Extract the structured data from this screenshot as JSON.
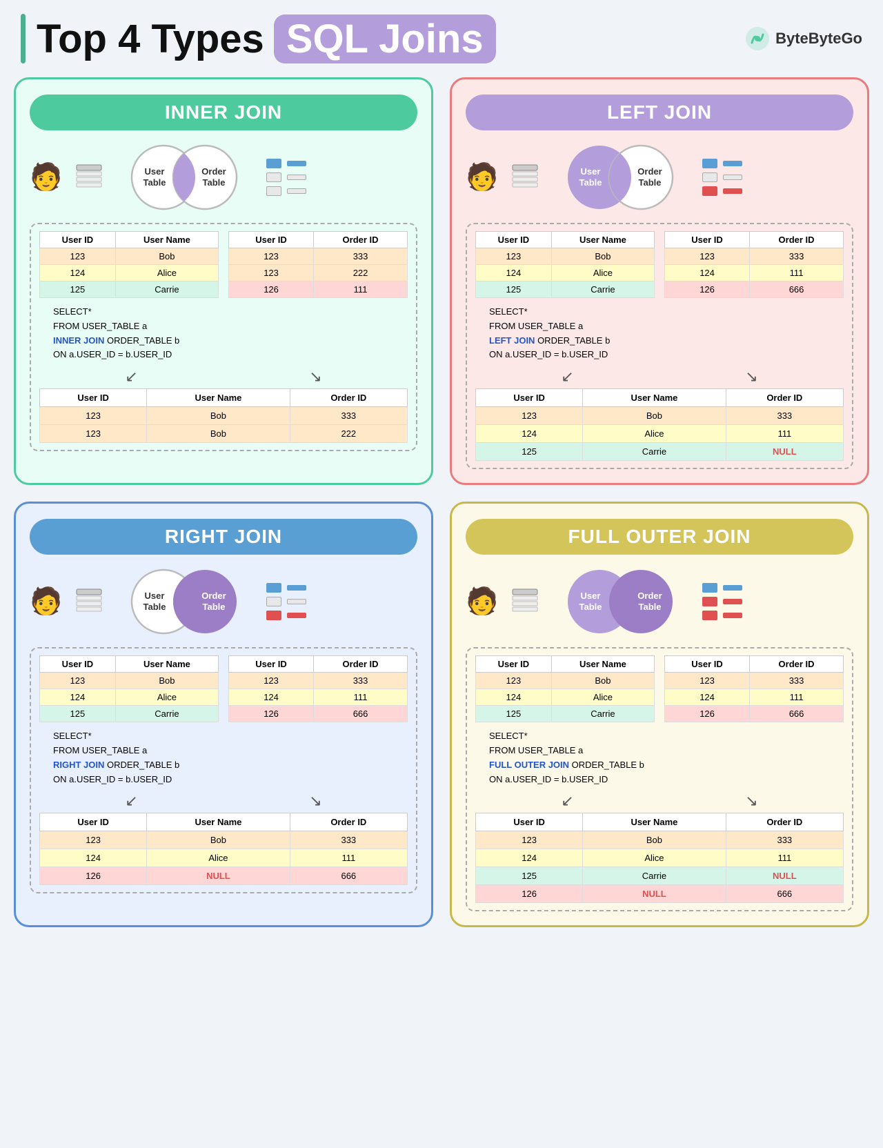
{
  "header": {
    "title_part1": "Top 4 Types",
    "title_accent": "SQL Joins",
    "brand": "ByteByteGo"
  },
  "inner_join": {
    "title": "INNER JOIN",
    "user_table": {
      "headers": [
        "User ID",
        "User Name"
      ],
      "rows": [
        {
          "id": "123",
          "name": "Bob",
          "color": "orange"
        },
        {
          "id": "124",
          "name": "Alice",
          "color": "yellow"
        },
        {
          "id": "125",
          "name": "Carrie",
          "color": "green"
        }
      ]
    },
    "order_table": {
      "headers": [
        "User ID",
        "Order ID"
      ],
      "rows": [
        {
          "id": "123",
          "order": "333",
          "color": "orange"
        },
        {
          "id": "123",
          "order": "222",
          "color": "orange"
        },
        {
          "id": "126",
          "order": "111",
          "color": "pink"
        }
      ]
    },
    "sql": {
      "line1": "SELECT*",
      "line2": "FROM USER_TABLE a",
      "line3_kw": "INNER JOIN",
      "line3_rest": " ORDER_TABLE b",
      "line4": "ON a.USER_ID = b.USER_ID"
    },
    "result_table": {
      "headers": [
        "User ID",
        "User Name",
        "Order ID"
      ],
      "rows": [
        {
          "id": "123",
          "name": "Bob",
          "order": "333",
          "color": "orange"
        },
        {
          "id": "123",
          "name": "Bob",
          "order": "222",
          "color": "orange"
        }
      ]
    }
  },
  "left_join": {
    "title": "LEFT JOIN",
    "user_table": {
      "headers": [
        "User ID",
        "User Name"
      ],
      "rows": [
        {
          "id": "123",
          "name": "Bob",
          "color": "orange"
        },
        {
          "id": "124",
          "name": "Alice",
          "color": "yellow"
        },
        {
          "id": "125",
          "name": "Carrie",
          "color": "green"
        }
      ]
    },
    "order_table": {
      "headers": [
        "User ID",
        "Order ID"
      ],
      "rows": [
        {
          "id": "123",
          "order": "333",
          "color": "orange"
        },
        {
          "id": "124",
          "order": "111",
          "color": "yellow"
        },
        {
          "id": "126",
          "order": "666",
          "color": "pink"
        }
      ]
    },
    "sql": {
      "line1": "SELECT*",
      "line2": "FROM USER_TABLE a",
      "line3_kw": "LEFT JOIN",
      "line3_rest": " ORDER_TABLE b",
      "line4": "ON a.USER_ID = b.USER_ID"
    },
    "result_table": {
      "headers": [
        "User ID",
        "User Name",
        "Order ID"
      ],
      "rows": [
        {
          "id": "123",
          "name": "Bob",
          "order": "333",
          "color": "orange",
          "null": false
        },
        {
          "id": "124",
          "name": "Alice",
          "order": "111",
          "color": "yellow",
          "null": false
        },
        {
          "id": "125",
          "name": "Carrie",
          "order": "NULL",
          "color": "green",
          "null": true
        }
      ]
    }
  },
  "right_join": {
    "title": "RIGHT JOIN",
    "user_table": {
      "headers": [
        "User ID",
        "User Name"
      ],
      "rows": [
        {
          "id": "123",
          "name": "Bob",
          "color": "orange"
        },
        {
          "id": "124",
          "name": "Alice",
          "color": "yellow"
        },
        {
          "id": "125",
          "name": "Carrie",
          "color": "green"
        }
      ]
    },
    "order_table": {
      "headers": [
        "User ID",
        "Order ID"
      ],
      "rows": [
        {
          "id": "123",
          "order": "333",
          "color": "orange"
        },
        {
          "id": "124",
          "order": "111",
          "color": "yellow"
        },
        {
          "id": "126",
          "order": "666",
          "color": "pink"
        }
      ]
    },
    "sql": {
      "line1": "SELECT*",
      "line2": "FROM USER_TABLE a",
      "line3_kw": "RIGHT JOIN",
      "line3_rest": " ORDER_TABLE b",
      "line4": "ON a.USER_ID = b.USER_ID"
    },
    "result_table": {
      "headers": [
        "User ID",
        "User Name",
        "Order ID"
      ],
      "rows": [
        {
          "id": "123",
          "name": "Bob",
          "order": "333",
          "color": "orange",
          "null": false
        },
        {
          "id": "124",
          "name": "Alice",
          "order": "111",
          "color": "yellow",
          "null": false
        },
        {
          "id": "126",
          "name": "NULL",
          "order": "666",
          "color": "pink",
          "null_name": true
        }
      ]
    }
  },
  "full_join": {
    "title": "FULL OUTER JOIN",
    "user_table": {
      "headers": [
        "User ID",
        "User Name"
      ],
      "rows": [
        {
          "id": "123",
          "name": "Bob",
          "color": "orange"
        },
        {
          "id": "124",
          "name": "Alice",
          "color": "yellow"
        },
        {
          "id": "125",
          "name": "Carrie",
          "color": "green"
        }
      ]
    },
    "order_table": {
      "headers": [
        "User ID",
        "Order ID"
      ],
      "rows": [
        {
          "id": "123",
          "order": "333",
          "color": "orange"
        },
        {
          "id": "124",
          "order": "111",
          "color": "yellow"
        },
        {
          "id": "126",
          "order": "666",
          "color": "pink"
        }
      ]
    },
    "sql": {
      "line1": "SELECT*",
      "line2": "FROM USER_TABLE a",
      "line3_kw": "FULL OUTER JOIN",
      "line3_rest": " ORDER_TABLE b",
      "line4": "ON a.USER_ID = b.USER_ID"
    },
    "result_table": {
      "headers": [
        "User ID",
        "User Name",
        "Order ID"
      ],
      "rows": [
        {
          "id": "123",
          "name": "Bob",
          "order": "333",
          "color": "orange"
        },
        {
          "id": "124",
          "name": "Alice",
          "order": "111",
          "color": "yellow"
        },
        {
          "id": "125",
          "name": "Carrie",
          "order": "NULL",
          "color": "green",
          "null_order": true
        },
        {
          "id": "126",
          "name": "NULL",
          "order": "666",
          "color": "pink",
          "null_name": true
        }
      ]
    }
  }
}
